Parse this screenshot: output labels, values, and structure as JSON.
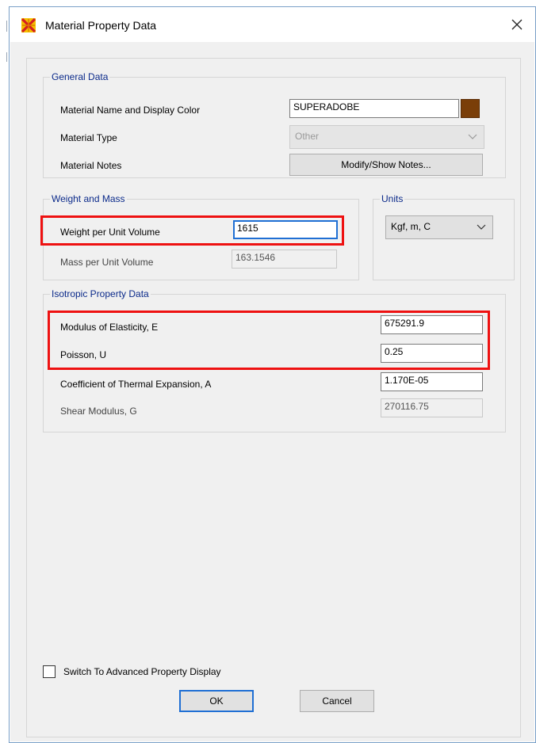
{
  "window": {
    "title": "Material Property Data",
    "close_symbol": "✕"
  },
  "general": {
    "legend": "General Data",
    "name_label": "Material Name and Display Color",
    "name_value": "SUPERADOBE",
    "display_color": "#7a3e08",
    "type_label": "Material Type",
    "type_value": "Other",
    "notes_label": "Material Notes",
    "notes_button": "Modify/Show Notes..."
  },
  "weight": {
    "legend": "Weight and Mass",
    "weight_label": "Weight per Unit Volume",
    "weight_value": "1615",
    "mass_label": "Mass per Unit Volume",
    "mass_value": "163.1546"
  },
  "units": {
    "legend": "Units",
    "value": "Kgf, m, C"
  },
  "isotropic": {
    "legend": "Isotropic Property Data",
    "e_label": "Modulus of Elasticity,  E",
    "e_value": "675291.9",
    "u_label": "Poisson,  U",
    "u_value": "0.25",
    "a_label": "Coefficient of Thermal Expansion,  A",
    "a_value": "1.170E-05",
    "g_label": "Shear Modulus,  G",
    "g_value": "270116.75"
  },
  "footer": {
    "advanced_label": "Switch To Advanced Property Display",
    "ok": "OK",
    "cancel": "Cancel"
  },
  "colors": {
    "highlight": "#ee1111",
    "legend_text": "#0b2a8a",
    "focus_border": "#1f6fd4"
  }
}
